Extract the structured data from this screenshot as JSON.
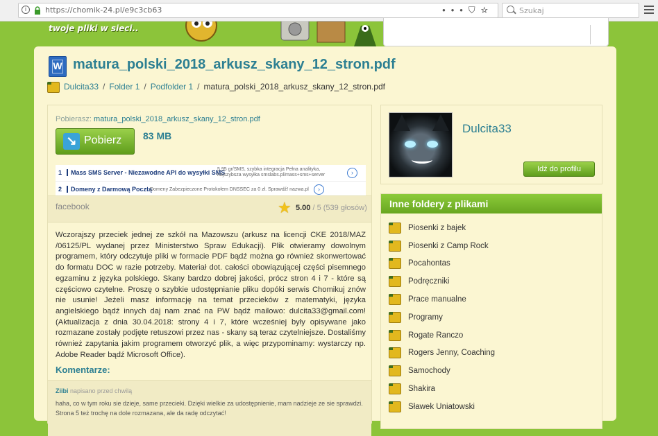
{
  "browser": {
    "url": "https://chomik-24.pl/e9c3cb63",
    "search_placeholder": "Szukaj",
    "icons": [
      "info-icon",
      "lock-icon",
      "more-icon",
      "shield-icon",
      "star-icon",
      "magnifier-icon",
      "menu-icon"
    ]
  },
  "site": {
    "tagline": "twoje pliki w sieci.."
  },
  "file": {
    "title": "matura_polski_2018_arkusz_skany_12_stron.pdf",
    "icon_letter": "W",
    "downloading_label": "Pobierasz:",
    "downloading_name": "matura_polski_2018_arkusz_skany_12_stron.pdf",
    "download_button": "Pobierz",
    "size": "83 MB"
  },
  "breadcrumb": {
    "items": [
      "Dulcita33",
      "Folder 1",
      "Podfolder 1"
    ],
    "separator": "/",
    "current": "matura_polski_2018_arkusz_skany_12_stron.pdf"
  },
  "ads": [
    {
      "num": "1",
      "title": "Mass SMS Server - Niezawodne API do wysyłki SMS",
      "desc1": "5,95 gr/SMS, szybka integracja Pełna analityka,",
      "desc2": "najszybsza wysyłka smslabs.pl/mass+sms+server"
    },
    {
      "num": "2",
      "title": "Domeny z Darmową Pocztą",
      "desc1": "Domeny Zabezpieczone Protokołem DNSSEC za 0 zł. Sprawdź! nazwa.pl",
      "desc2": ""
    }
  ],
  "social": {
    "facebook": "facebook",
    "rating_value": "5.00",
    "rating_rest": "/ 5 (539 głosów)",
    "rating_fraction": 1.0
  },
  "description": "Wczorajszy przeciek jednej ze szkół na Mazowszu (arkusz na licencji CKE 2018/MAZ /06125/PL wydanej przez Ministerstwo Spraw Edukacji). Plik otwieramy dowolnym programem, który odczytuje pliki w formacie PDF bądź można go również skonwertować do formatu DOC w razie potrzeby. Materiał dot. całości obowiązującej części pisemnego egzaminu z języka polskiego. Skany bardzo dobrej jakości, prócz stron 4 i 7 - które są częściowo czytelne. Proszę o szybkie udostępnianie pliku dopóki serwis Chomikuj znów nie usunie! Jeżeli masz informację na temat przecieków z matematyki, języka angielskiego bądź innych daj nam znać na PW bądź mailowo: dulcita33@gmail.com! (Aktualizacja z dnia 30.04.2018: strony 4 i 7, które wcześniej były opisywane jako rozmazane zostały podjęte retuszowi przez nas - skany są teraz czytelniejsze. Dostaliśmy również zapytania jakim programem otworzyć plik, a więc przypominamy: wystarczy np. Adobe Reader bądź Microsoft Office).",
  "comments": {
    "heading": "Komentarze:",
    "author": "Ziibi",
    "meta": "napisano przed chwilą",
    "text": "haha, co w tym roku sie dzieje, same przecieki. Dzięki wielkie za udostępnienie, mam nadzieje ze sie sprawdzi. Strona 5 też trochę na dole rozmazana, ale da radę odczytać!"
  },
  "profile": {
    "username": "Dulcita33",
    "button": "Idź do profilu"
  },
  "folders": {
    "heading": "Inne foldery z plikami",
    "items": [
      "Piosenki z bajek",
      "Piosenki z Camp Rock",
      "Pocahontas",
      "Podręczniki",
      "Prace manualne",
      "Programy",
      "Rogate Ranczo",
      "Rogers Jenny, Coaching",
      "Samochody",
      "Shakira",
      "Sławek Uniatowski"
    ]
  },
  "colors": {
    "accent_green": "#8cc43a",
    "title_teal": "#2c7f92",
    "panel_bg": "#fbf6d2"
  }
}
